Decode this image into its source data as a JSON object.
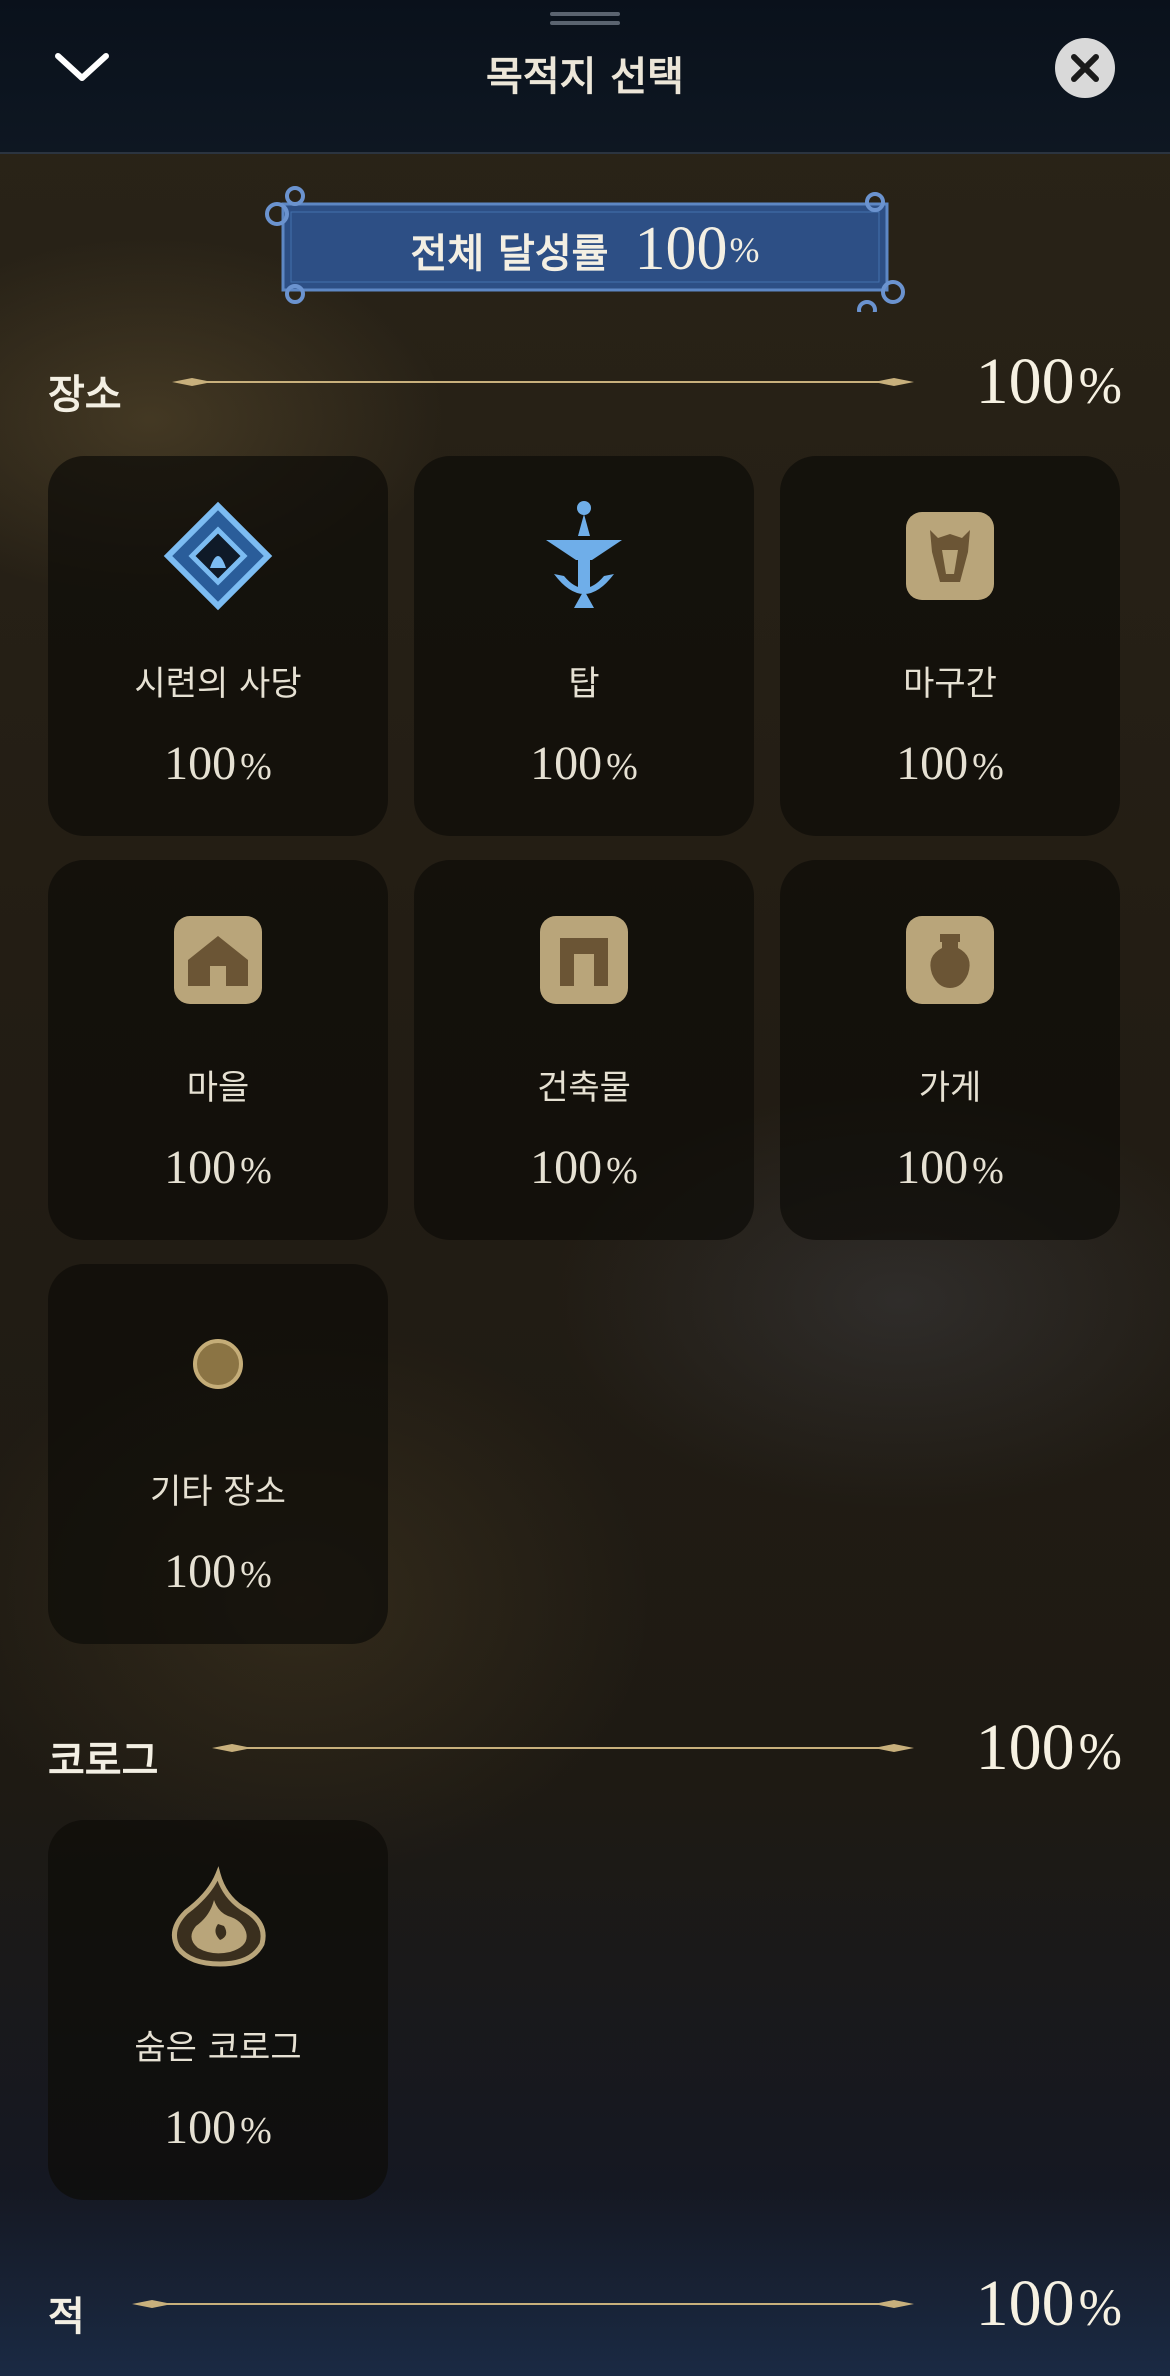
{
  "header": {
    "title": "목적지 선택"
  },
  "banner": {
    "label": "전체 달성률",
    "value": "100",
    "unit": "%"
  },
  "sections": [
    {
      "title": "장소",
      "value": "100",
      "unit": "%",
      "cards": [
        {
          "icon": "shrine-icon",
          "label": "시련의 사당",
          "value": "100",
          "unit": "%"
        },
        {
          "icon": "tower-icon",
          "label": "탑",
          "value": "100",
          "unit": "%"
        },
        {
          "icon": "stable-icon",
          "label": "마구간",
          "value": "100",
          "unit": "%"
        },
        {
          "icon": "village-icon",
          "label": "마을",
          "value": "100",
          "unit": "%"
        },
        {
          "icon": "structure-icon",
          "label": "건축물",
          "value": "100",
          "unit": "%"
        },
        {
          "icon": "shop-icon",
          "label": "가게",
          "value": "100",
          "unit": "%"
        },
        {
          "icon": "other-location-icon",
          "label": "기타 장소",
          "value": "100",
          "unit": "%"
        }
      ]
    },
    {
      "title": "코로그",
      "value": "100",
      "unit": "%",
      "cards": [
        {
          "icon": "korok-seed-icon",
          "label": "숨은 코로그",
          "value": "100",
          "unit": "%"
        }
      ]
    },
    {
      "title": "적",
      "value": "100",
      "unit": "%"
    }
  ],
  "colors": {
    "gold": "#c8b07c",
    "iconTan": "#b9a57a",
    "shrineBlue": "#5fa3e6",
    "banner": "#2d4f85"
  }
}
